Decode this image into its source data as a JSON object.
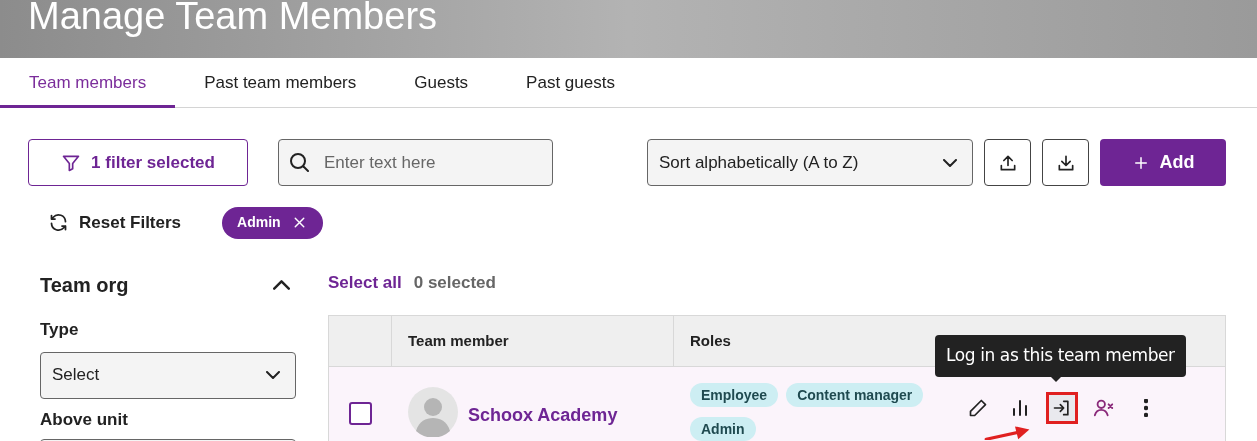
{
  "header": {
    "title": "Manage Team Members"
  },
  "tabs": [
    {
      "label": "Team members",
      "selected": true
    },
    {
      "label": "Past team members",
      "selected": false
    },
    {
      "label": "Guests",
      "selected": false
    },
    {
      "label": "Past guests",
      "selected": false
    }
  ],
  "toolbar": {
    "filter_button": "1 filter selected",
    "search": {
      "placeholder": "Enter text here"
    },
    "sort": {
      "value": "Sort alphabetically (A to Z)"
    },
    "add_button": "Add"
  },
  "reset_filters": "Reset Filters",
  "active_filters": [
    {
      "label": "Admin"
    }
  ],
  "sidebar": {
    "section": {
      "title": "Team org",
      "expanded": true,
      "fields": [
        {
          "label": "Type",
          "value": "Select"
        },
        {
          "label": "Above unit"
        }
      ]
    }
  },
  "selection": {
    "select_all": "Select all",
    "count": "0 selected"
  },
  "table": {
    "columns": [
      "Team member",
      "Roles"
    ],
    "rows": [
      {
        "name": "Schoox Academy",
        "checked": false,
        "roles": [
          "Employee",
          "Content manager",
          "Admin"
        ]
      }
    ]
  },
  "tooltip": "Log in as this team member"
}
